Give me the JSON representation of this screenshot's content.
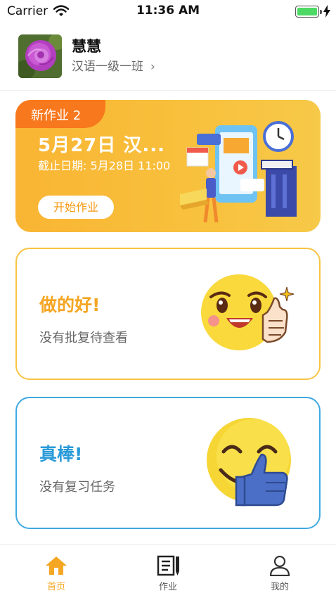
{
  "status_bar": {
    "carrier": "Carrier",
    "time": "11:36 AM"
  },
  "profile": {
    "name": "慧慧",
    "class_name": "汉语一级一班",
    "chevron": "›"
  },
  "homework": {
    "badge": "新作业 2",
    "title": "5月27日 汉...",
    "deadline": "截止日期: 5月28日 11:00",
    "start_button": "开始作业"
  },
  "feedback": [
    {
      "title": "做的好!",
      "subtitle": "没有批复待查看",
      "accent": "#f8c445"
    },
    {
      "title": "真棒!",
      "subtitle": "没有复习任务",
      "accent": "#3fa9e0"
    }
  ],
  "tabs": [
    {
      "label": "首页",
      "icon": "home-icon",
      "active": true
    },
    {
      "label": "作业",
      "icon": "homework-icon",
      "active": false
    },
    {
      "label": "我的",
      "icon": "profile-icon",
      "active": false
    }
  ],
  "colors": {
    "active_tab": "#f5a623",
    "card_orange": "#f9b534",
    "badge_orange": "#f8781d",
    "blue_accent": "#2a9ad8"
  }
}
